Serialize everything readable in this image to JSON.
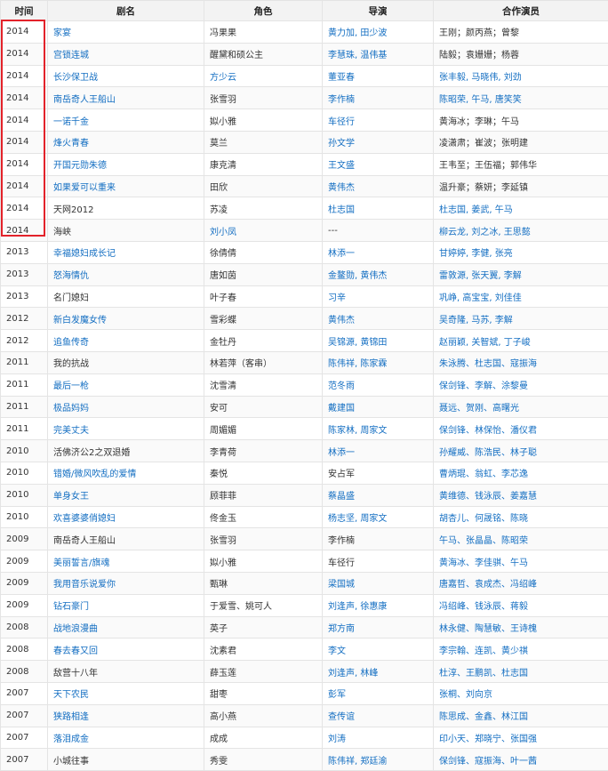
{
  "table": {
    "headers": [
      "时间",
      "剧名",
      "角色",
      "导演",
      "合作演员"
    ],
    "rows": [
      {
        "year": "2014",
        "title": "家宴",
        "title_link": true,
        "role": "冯果果",
        "director": "黄力加, 田少波",
        "director_link": true,
        "costars": "王刚；颜丙燕；曾黎",
        "costars_link": false
      },
      {
        "year": "2014",
        "title": "宫锁连城",
        "title_link": true,
        "role": "醒黛和硕公主",
        "director": "李慧珠, 温伟基",
        "director_link": true,
        "costars": "陆毅；袁姗姗；杨蓉",
        "costars_link": false
      },
      {
        "year": "2014",
        "title": "长沙保卫战",
        "title_link": true,
        "role": "方少云",
        "role_link": true,
        "director": "董亚春",
        "director_link": true,
        "costars": "张丰毅, 马晓伟, 刘劲",
        "costars_link": true
      },
      {
        "year": "2014",
        "title": "南岳奇人王船山",
        "title_link": true,
        "role": "张雪羽",
        "director": "李作楠",
        "director_link": true,
        "costars": "陈昭荣, 午马, 唐笑笑",
        "costars_link": true
      },
      {
        "year": "2014",
        "title": "一诺千金",
        "title_link": true,
        "role": "姒小雅",
        "director": "车径行",
        "director_link": true,
        "costars": "黄海冰；李琳；午马",
        "costars_link": false
      },
      {
        "year": "2014",
        "title": "烽火青春",
        "title_link": true,
        "role": "莫兰",
        "director": "孙文学",
        "director_link": true,
        "costars": "凌潇肃；崔波；张明建",
        "costars_link": false
      },
      {
        "year": "2014",
        "title": "开国元勋朱德",
        "title_link": true,
        "role": "康克清",
        "director": "王文盛",
        "director_link": true,
        "costars": "王韦至；王伍福；郭伟华",
        "costars_link": false
      },
      {
        "year": "2014",
        "title": "如果爱可以重来",
        "title_link": true,
        "role": "田欣",
        "director": "黄伟杰",
        "director_link": true,
        "costars": "温升豪；蔡妍；李延镇",
        "costars_link": false
      },
      {
        "year": "2014",
        "title": "天网2012",
        "title_link": false,
        "role": "苏凌",
        "director": "杜志国",
        "director_link": true,
        "costars": "杜志国, 姜武, 午马",
        "costars_link": true
      },
      {
        "year": "2014",
        "title": "海峡",
        "title_link": false,
        "role": "刘小凤",
        "role_link": true,
        "director": "---",
        "director_link": false,
        "costars": "柳云龙, 刘之冰, 王思懿",
        "costars_link": true
      },
      {
        "year": "2013",
        "title": "幸福媳妇成长记",
        "title_link": true,
        "role": "徐倩倩",
        "director": "林添一",
        "director_link": true,
        "costars": "甘婷婷, 李健, 张亮",
        "costars_link": true
      },
      {
        "year": "2013",
        "title": "怒海情仇",
        "title_link": true,
        "role": "唐如茵",
        "director": "金鳌勋, 黄伟杰",
        "director_link": true,
        "costars": "雷敦源, 张天翼, 李解",
        "costars_link": true
      },
      {
        "year": "2013",
        "title": "名门媳妇",
        "title_link": false,
        "role": "叶子春",
        "director": "习辛",
        "director_link": true,
        "costars": "巩峥, 高宝宝, 刘佳佳",
        "costars_link": true
      },
      {
        "year": "2012",
        "title": "新白发魔女传",
        "title_link": true,
        "role": "雪彩蝶",
        "director": "黄伟杰",
        "director_link": true,
        "costars": "吴奇隆, 马苏, 李解",
        "costars_link": true
      },
      {
        "year": "2012",
        "title": "追鱼传奇",
        "title_link": true,
        "role": "金牡丹",
        "director": "吴锦源, 黄锦田",
        "director_link": true,
        "costars": "赵丽颖, 关智斌, 丁子峻",
        "costars_link": true
      },
      {
        "year": "2011",
        "title": "我的抗战",
        "title_link": false,
        "role": "林若萍（客串）",
        "director": "陈伟祥, 陈家霖",
        "director_link": true,
        "costars": "朱泳腾、杜志国、寇振海",
        "costars_link": true
      },
      {
        "year": "2011",
        "title": "最后一枪",
        "title_link": true,
        "role": "沈雪清",
        "director": "范冬雨",
        "director_link": true,
        "costars": "保剑锋、李解、涂黎曼",
        "costars_link": true
      },
      {
        "year": "2011",
        "title": "极品妈妈",
        "title_link": true,
        "role": "安可",
        "director": "戴建国",
        "director_link": true,
        "costars": "聂远、贺刚、高曙光",
        "costars_link": true
      },
      {
        "year": "2011",
        "title": "完美丈夫",
        "title_link": true,
        "role": "周媚媚",
        "director": "陈家林, 周家文",
        "director_link": true,
        "costars": "保剑锋、林保怡、潘仪君",
        "costars_link": true
      },
      {
        "year": "2010",
        "title": "活佛济公2之双退婚",
        "title_link": false,
        "role": "李青荷",
        "director": "林添一",
        "director_link": true,
        "costars": "孙耀威、陈浩民、林子聪",
        "costars_link": true
      },
      {
        "year": "2010",
        "title": "错婚/微风吹乱的爱情",
        "title_link": true,
        "role": "秦悦",
        "director": "安占军",
        "director_link": false,
        "costars": "曹炳琨、翁虹、李芯逸",
        "costars_link": true
      },
      {
        "year": "2010",
        "title": "单身女王",
        "title_link": true,
        "role": "顾菲菲",
        "director": "蔡晶盛",
        "director_link": true,
        "costars": "黄维德、钱泳辰、姜嘉慧",
        "costars_link": true
      },
      {
        "year": "2010",
        "title": "欢喜婆婆俏媳妇",
        "title_link": true,
        "role": "佟金玉",
        "director": "杨志坚, 周家文",
        "director_link": true,
        "costars": "胡杏儿、何晟铭、陈晓",
        "costars_link": true
      },
      {
        "year": "2009",
        "title": "南岳奇人王船山",
        "title_link": false,
        "role": "张雪羽",
        "director": "李作楠",
        "director_link": false,
        "costars": "午马、张晶晶、陈昭荣",
        "costars_link": true
      },
      {
        "year": "2009",
        "title": "美丽誓言/旗魂",
        "title_link": true,
        "role": "姒小雅",
        "director": "车径行",
        "director_link": false,
        "costars": "黄海冰、李佳骐、午马",
        "costars_link": true
      },
      {
        "year": "2009",
        "title": "我用音乐说爱你",
        "title_link": true,
        "role": "甄琳",
        "director": "梁国城",
        "director_link": true,
        "costars": "唐嘉哲、袁成杰、冯绍峰",
        "costars_link": true
      },
      {
        "year": "2009",
        "title": "钻石豪门",
        "title_link": true,
        "role": "于爱雪、姚可人",
        "director": "刘逢声, 徐惠康",
        "director_link": true,
        "costars": "冯绍峰、钱泳辰、蒋毅",
        "costars_link": true
      },
      {
        "year": "2008",
        "title": "战地浪漫曲",
        "title_link": true,
        "role": "英子",
        "director": "郑方南",
        "director_link": true,
        "costars": "林永健、陶慧敏、王诗槐",
        "costars_link": true
      },
      {
        "year": "2008",
        "title": "春去春又回",
        "title_link": true,
        "role": "沈素君",
        "director": "李文",
        "director_link": true,
        "costars": "李宗翰、连凯、黄少祺",
        "costars_link": true
      },
      {
        "year": "2008",
        "title": "敌营十八年",
        "title_link": false,
        "role": "薛玉莲",
        "director": "刘逢声, 林峰",
        "director_link": true,
        "costars": "杜淳、王鹏凯、杜志国",
        "costars_link": true
      },
      {
        "year": "2007",
        "title": "天下农民",
        "title_link": true,
        "role": "甜枣",
        "director": "彭军",
        "director_link": true,
        "costars": "张桐、刘向京",
        "costars_link": true
      },
      {
        "year": "2007",
        "title": "狭路相逢",
        "title_link": true,
        "role": "高小燕",
        "director": "查传谊",
        "director_link": true,
        "costars": "陈思成、金鑫、林江国",
        "costars_link": true
      },
      {
        "year": "2007",
        "title": "落泪成金",
        "title_link": true,
        "role": "成成",
        "director": "刘涛",
        "director_link": true,
        "costars": "印小天、郑晓宁、张国强",
        "costars_link": true
      },
      {
        "year": "2007",
        "title": "小城往事",
        "title_link": false,
        "role": "秀雯",
        "director": "陈伟祥, 郑廷渝",
        "director_link": true,
        "costars": "保剑锋、寇振海、叶一茜",
        "costars_link": true
      }
    ]
  },
  "colors": {
    "link": "#136ec2",
    "text": "#333333",
    "header_bg": "#f3f3f3",
    "border": "#e4e4e4",
    "highlight": "#e3222a"
  }
}
